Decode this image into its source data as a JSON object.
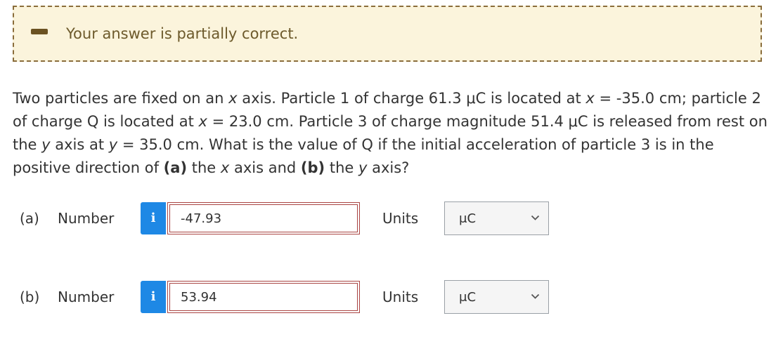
{
  "feedback": {
    "status": "partial",
    "message": "Your answer is partially correct."
  },
  "question": {
    "t1": "Two particles are fixed on an ",
    "v1": "x",
    "t2": " axis. Particle 1 of charge 61.3 μC is located at ",
    "v2": "x",
    "t3": " = -35.0 cm; particle 2 of charge Q is located at ",
    "v3": "x",
    "t4": " = 23.0 cm. Particle 3 of charge magnitude 51.4 μC is released from rest on the ",
    "v4": "y",
    "t5": " axis at ",
    "v5": "y",
    "t6": " = 35.0 cm. What is the value of Q if the initial acceleration of particle 3 is in the positive direction of ",
    "b1": "(a)",
    "t7": " the ",
    "v6": "x",
    "t8": " axis and ",
    "b2": "(b)",
    "t9": " the ",
    "v7": "y",
    "t10": " axis?"
  },
  "parts": [
    {
      "label": "(a)",
      "number_label": "Number",
      "info_glyph": "i",
      "info_icon": "info-icon",
      "value": "-47.93",
      "state": "incorrect",
      "units_label": "Units",
      "unit": "μC",
      "dropdown_icon": "chevron-down-icon"
    },
    {
      "label": "(b)",
      "number_label": "Number",
      "info_glyph": "i",
      "info_icon": "info-icon",
      "value": "53.94",
      "state": "incorrect",
      "units_label": "Units",
      "unit": "μC",
      "dropdown_icon": "chevron-down-icon"
    }
  ],
  "colors": {
    "feedback_bg": "#fbf4dc",
    "feedback_border": "#8a6d3b",
    "info_button": "#1e88e5",
    "error_border": "#a94442"
  }
}
